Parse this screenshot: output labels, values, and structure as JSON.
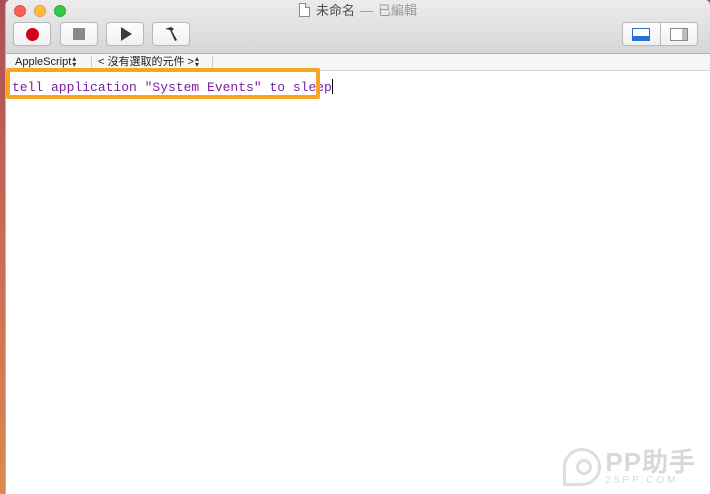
{
  "window": {
    "title": "未命名",
    "title_separator": "—",
    "status": "已編輯"
  },
  "toolbar": {
    "buttons": [
      {
        "icon": "record-icon",
        "color": "#d0021b"
      },
      {
        "icon": "stop-icon"
      },
      {
        "icon": "play-icon"
      },
      {
        "icon": "hammer-icon"
      }
    ],
    "view_toggle": [
      "panel-bottom-icon",
      "panel-side-icon"
    ]
  },
  "navbar": {
    "language": "AppleScript",
    "element_selector": "< 沒有選取的元件 >"
  },
  "editor": {
    "code": "tell application \"System Events\" to sleep",
    "highlight_color": "#f5a623"
  },
  "watermark": {
    "brand": "PP助手",
    "url": "25PP.COM"
  }
}
